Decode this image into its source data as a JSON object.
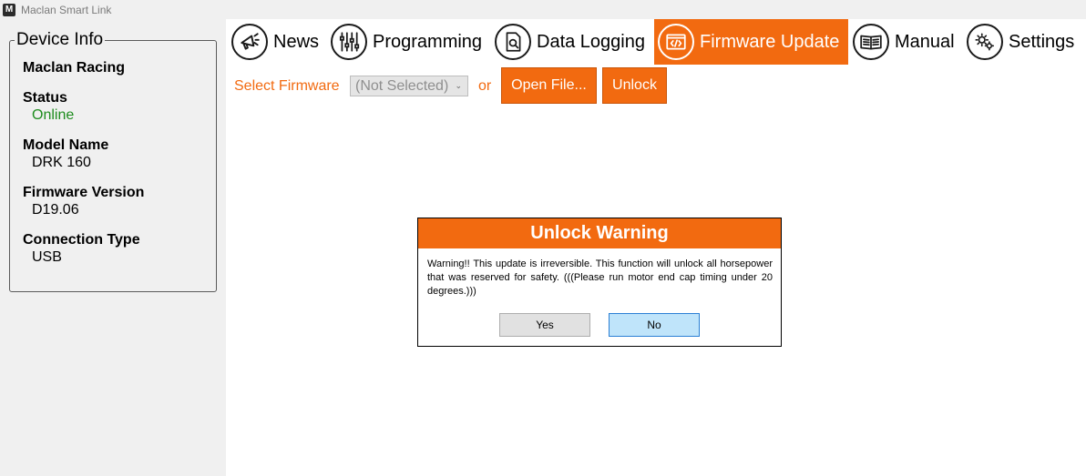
{
  "window": {
    "title": "Maclan Smart Link",
    "icon": "maclan-logo-icon"
  },
  "device_info": {
    "group_title": "Device Info",
    "brand": "Maclan Racing",
    "status_label": "Status",
    "status_value": "Online",
    "model_label": "Model Name",
    "model_value": "DRK 160",
    "firmware_label": "Firmware Version",
    "firmware_value": "D19.06",
    "connection_label": "Connection Type",
    "connection_value": "USB"
  },
  "nav": {
    "active": "Firmware Update",
    "items": [
      {
        "label": "News",
        "icon": "megaphone-icon"
      },
      {
        "label": "Programming",
        "icon": "sliders-icon"
      },
      {
        "label": "Data Logging",
        "icon": "document-search-icon"
      },
      {
        "label": "Firmware Update",
        "icon": "code-window-icon"
      },
      {
        "label": "Manual",
        "icon": "book-icon"
      },
      {
        "label": "Settings",
        "icon": "gears-icon"
      }
    ]
  },
  "toolbar": {
    "select_label": "Select Firmware",
    "select_value": "(Not Selected)",
    "or_label": "or",
    "open_file_label": "Open File...",
    "unlock_label": "Unlock"
  },
  "dialog": {
    "title": "Unlock Warning",
    "message": "Warning!! This update is irreversible. This function will unlock all horsepower that was reserved for safety. (((Please run motor end cap timing under 20 degrees.)))",
    "yes_label": "Yes",
    "no_label": "No"
  },
  "colors": {
    "accent": "#f26a10",
    "online": "#1e8c1e",
    "panel": "#f0f0f0",
    "no_button": "#bfe4fa"
  }
}
